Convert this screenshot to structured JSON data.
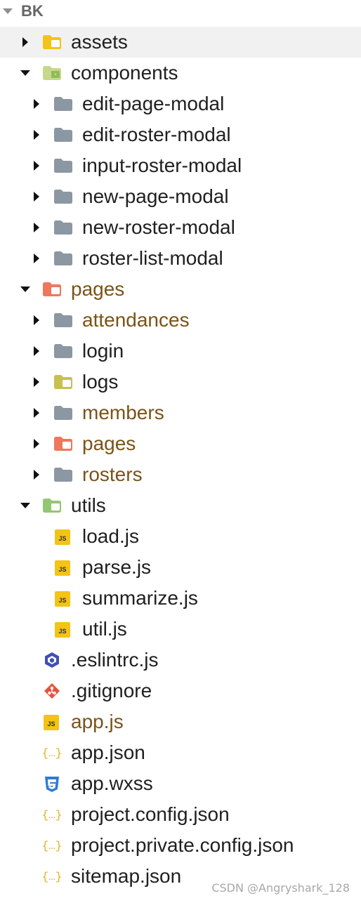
{
  "root": {
    "label": "BK"
  },
  "items": [
    {
      "label": "assets",
      "depth": 0,
      "expanded": false,
      "icon": "folder-assets-icon",
      "color": "#1f1f1f",
      "selected": true
    },
    {
      "label": "components",
      "depth": 0,
      "expanded": true,
      "icon": "folder-components-icon",
      "color": "#1f1f1f"
    },
    {
      "label": "edit-page-modal",
      "depth": 1,
      "expanded": false,
      "icon": "folder-icon",
      "color": "#1f1f1f"
    },
    {
      "label": "edit-roster-modal",
      "depth": 1,
      "expanded": false,
      "icon": "folder-icon",
      "color": "#1f1f1f"
    },
    {
      "label": "input-roster-modal",
      "depth": 1,
      "expanded": false,
      "icon": "folder-icon",
      "color": "#1f1f1f"
    },
    {
      "label": "new-page-modal",
      "depth": 1,
      "expanded": false,
      "icon": "folder-icon",
      "color": "#1f1f1f"
    },
    {
      "label": "new-roster-modal",
      "depth": 1,
      "expanded": false,
      "icon": "folder-icon",
      "color": "#1f1f1f"
    },
    {
      "label": "roster-list-modal",
      "depth": 1,
      "expanded": false,
      "icon": "folder-icon",
      "color": "#1f1f1f"
    },
    {
      "label": "pages",
      "depth": 0,
      "expanded": true,
      "icon": "folder-pages-icon",
      "color": "#7a5317"
    },
    {
      "label": "attendances",
      "depth": 1,
      "expanded": false,
      "icon": "folder-icon",
      "color": "#7a5317"
    },
    {
      "label": "login",
      "depth": 1,
      "expanded": false,
      "icon": "folder-icon",
      "color": "#1f1f1f"
    },
    {
      "label": "logs",
      "depth": 1,
      "expanded": false,
      "icon": "folder-logs-icon",
      "color": "#1f1f1f"
    },
    {
      "label": "members",
      "depth": 1,
      "expanded": false,
      "icon": "folder-icon",
      "color": "#7a5317"
    },
    {
      "label": "pages",
      "depth": 1,
      "expanded": false,
      "icon": "folder-pages-icon",
      "color": "#7a5317"
    },
    {
      "label": "rosters",
      "depth": 1,
      "expanded": false,
      "icon": "folder-icon",
      "color": "#7a5317"
    },
    {
      "label": "utils",
      "depth": 0,
      "expanded": true,
      "icon": "folder-utils-icon",
      "color": "#1f1f1f"
    },
    {
      "label": "load.js",
      "depth": 1,
      "leaf": true,
      "icon": "js-file-icon",
      "color": "#1f1f1f"
    },
    {
      "label": "parse.js",
      "depth": 1,
      "leaf": true,
      "icon": "js-file-icon",
      "color": "#1f1f1f"
    },
    {
      "label": "summarize.js",
      "depth": 1,
      "leaf": true,
      "icon": "js-file-icon",
      "color": "#1f1f1f"
    },
    {
      "label": "util.js",
      "depth": 1,
      "leaf": true,
      "icon": "js-file-icon",
      "color": "#1f1f1f"
    },
    {
      "label": ".eslintrc.js",
      "depth": 0,
      "leaf": true,
      "icon": "eslint-icon",
      "color": "#1f1f1f"
    },
    {
      "label": ".gitignore",
      "depth": 0,
      "leaf": true,
      "icon": "git-icon",
      "color": "#1f1f1f"
    },
    {
      "label": "app.js",
      "depth": 0,
      "leaf": true,
      "icon": "js-file-icon",
      "color": "#7a5317"
    },
    {
      "label": "app.json",
      "depth": 0,
      "leaf": true,
      "icon": "json-file-icon",
      "color": "#1f1f1f"
    },
    {
      "label": "app.wxss",
      "depth": 0,
      "leaf": true,
      "icon": "css-file-icon",
      "color": "#1f1f1f"
    },
    {
      "label": "project.config.json",
      "depth": 0,
      "leaf": true,
      "icon": "json-file-icon",
      "color": "#1f1f1f"
    },
    {
      "label": "project.private.config.json",
      "depth": 0,
      "leaf": true,
      "icon": "json-file-icon",
      "color": "#1f1f1f"
    },
    {
      "label": "sitemap.json",
      "depth": 0,
      "leaf": true,
      "icon": "json-file-icon",
      "color": "#1f1f1f"
    }
  ],
  "watermark": "CSDN @Angryshark_128"
}
